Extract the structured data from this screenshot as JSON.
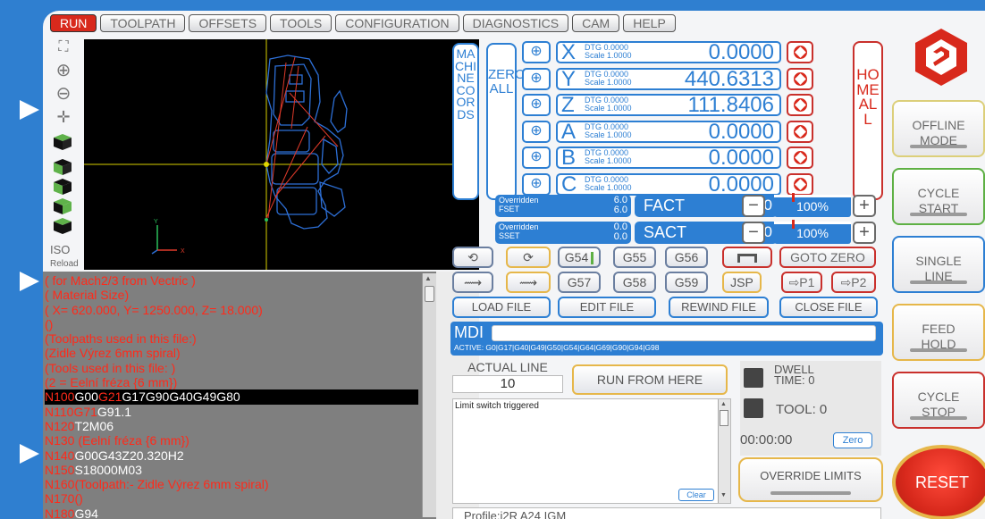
{
  "tabs": [
    "RUN",
    "TOOLPATH",
    "OFFSETS",
    "TOOLS",
    "CONFIGURATION",
    "DIAGNOSTICS",
    "CAM",
    "HELP"
  ],
  "view_tools": {
    "iso_label": "ISO",
    "reload_label": "Reload"
  },
  "dro": {
    "machine_coords_label": "MACHINE COORDS",
    "zero_all_label": "ZERO ALL",
    "home_all_label": "HOME ALL",
    "dtg_label": "DTG",
    "scale_label": "Scale",
    "axes": [
      {
        "letter": "X",
        "dtg": "0.0000",
        "scale": "1.0000",
        "value": "0.0000"
      },
      {
        "letter": "Y",
        "dtg": "0.0000",
        "scale": "1.0000",
        "value": "440.6313"
      },
      {
        "letter": "Z",
        "dtg": "0.0000",
        "scale": "1.0000",
        "value": "111.8406"
      },
      {
        "letter": "A",
        "dtg": "0.0000",
        "scale": "1.0000",
        "value": "0.0000"
      },
      {
        "letter": "B",
        "dtg": "0.0000",
        "scale": "1.0000",
        "value": "0.0000"
      },
      {
        "letter": "C",
        "dtg": "0.0000",
        "scale": "1.0000",
        "value": "0.0000"
      }
    ]
  },
  "feed": {
    "overridden": "Overridden",
    "set_label": "FSET",
    "set_top": "6.0",
    "set_bottom": "6.0",
    "act_label": "FACT",
    "act_value": "0.0",
    "pct": "100%"
  },
  "spindle": {
    "overridden": "Overridden",
    "set_label": "SSET",
    "set_top": "0.0",
    "set_bottom": "0.0",
    "act_label": "SACT",
    "act_value": "0.0",
    "pct": "100%"
  },
  "wcs": {
    "g54": "G54",
    "g55": "G55",
    "g56": "G56",
    "g57": "G57",
    "g58": "G58",
    "g59": "G59",
    "jsp": "JSP",
    "p1": "P1",
    "p2": "P2",
    "goto_zero": "GOTO ZERO"
  },
  "file_buttons": {
    "load": "LOAD FILE",
    "edit": "EDIT FILE",
    "rewind": "REWIND FILE",
    "close": "CLOSE FILE"
  },
  "mdi": {
    "label": "MDI",
    "value": "",
    "active": "ACTIVE: G0|G17|G40|G49|G50|G54|G64|G69|G90|G94|G98"
  },
  "gcode": [
    [
      [
        "r",
        "( for Mach2/3 from Vectric )"
      ]
    ],
    [
      [
        "r",
        "( Material Size)"
      ]
    ],
    [
      [
        "r",
        "( X= 620.000, Y= 1250.000, Z= 18.000)"
      ]
    ],
    [
      [
        "r",
        "()"
      ]
    ],
    [
      [
        "r",
        "(Toolpaths used in this file:)"
      ]
    ],
    [
      [
        "r",
        "(Zidle Výrez 6mm spiral)"
      ]
    ],
    [
      [
        "r",
        "(Tools used in this file: )"
      ]
    ],
    [
      [
        "r",
        "(2 = Eelní fréza {6 mm})"
      ]
    ],
    [
      [
        "r",
        "N100"
      ],
      [
        "w",
        "G00"
      ],
      [
        "r",
        "G21"
      ],
      [
        "w",
        "G17G90G40G49G80"
      ]
    ],
    [
      [
        "r",
        "N110"
      ],
      [
        "r",
        "G71"
      ],
      [
        "w",
        "G91.1"
      ]
    ],
    [
      [
        "r",
        "N120"
      ],
      [
        "w",
        "T2M06"
      ]
    ],
    [
      [
        "r",
        "N130 (Eelní fréza {6 mm})"
      ]
    ],
    [
      [
        "r",
        "N140"
      ],
      [
        "w",
        "G00G43Z20.320H2"
      ]
    ],
    [
      [
        "r",
        "N150"
      ],
      [
        "w",
        "S18000M03"
      ]
    ],
    [
      [
        "r",
        "N160(Toolpath:- Zidle Výrez 6mm spiral)"
      ]
    ],
    [
      [
        "r",
        "N170()"
      ]
    ],
    [
      [
        "r",
        "N180"
      ],
      [
        "w",
        "G94"
      ]
    ]
  ],
  "actual_line": {
    "label": "ACTUAL LINE",
    "value": "10"
  },
  "run_from_here": "RUN FROM HERE",
  "dwell": {
    "label1": "DWELL",
    "label2": "TIME: 0"
  },
  "tool": {
    "label": "TOOL:  0"
  },
  "timer": {
    "value": "00:00:00",
    "zero": "Zero"
  },
  "override_limits": "OVERRIDE LIMITS",
  "status": {
    "message": "Limit switch triggered",
    "clear": "Clear"
  },
  "profile": "Profile:i2R  A24  IGM",
  "right_buttons": {
    "offline": [
      "OFFLINE",
      "MODE"
    ],
    "cycle_start": [
      "CYCLE",
      "START"
    ],
    "single_line": [
      "SINGLE",
      "LINE"
    ],
    "feed_hold": [
      "FEED",
      "HOLD"
    ],
    "cycle_stop": [
      "CYCLE",
      "STOP"
    ],
    "reset": "RESET"
  },
  "colors": {
    "run_tab": "#d8291c",
    "accent_blue": "#2d7fd3",
    "reset_red": "#d8291c",
    "gcode_bg": "#7f7f7f"
  }
}
